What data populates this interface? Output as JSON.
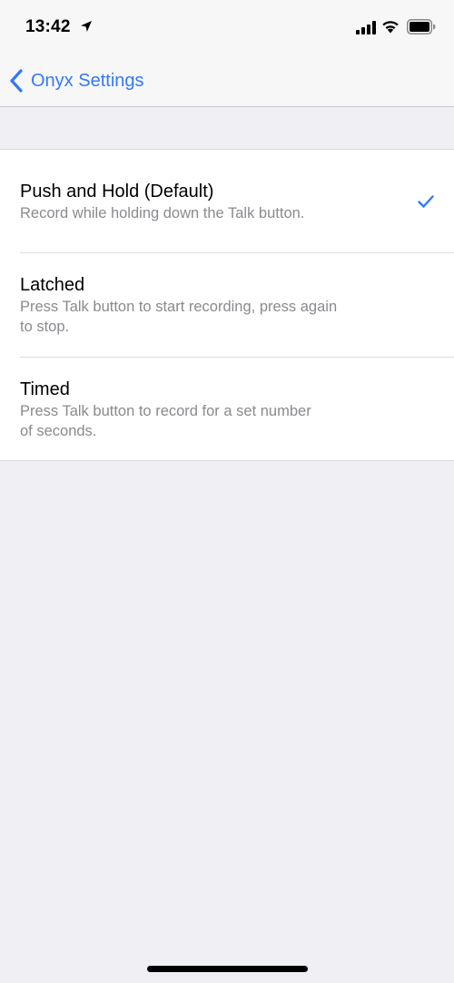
{
  "status_bar": {
    "time": "13:42"
  },
  "nav": {
    "back_label": "Onyx Settings"
  },
  "accent_color": "#3478f6",
  "options": [
    {
      "title": "Push and Hold (Default)",
      "subtitle_line1": "Record while holding down the Talk button.",
      "subtitle_line2": "",
      "selected": true
    },
    {
      "title": "Latched",
      "subtitle_line1": "Press Talk button to start recording, press again",
      "subtitle_line2": "to stop.",
      "selected": false
    },
    {
      "title": "Timed",
      "subtitle_line1": "Press Talk button to record for a set number",
      "subtitle_line2": "of seconds.",
      "selected": false
    }
  ]
}
